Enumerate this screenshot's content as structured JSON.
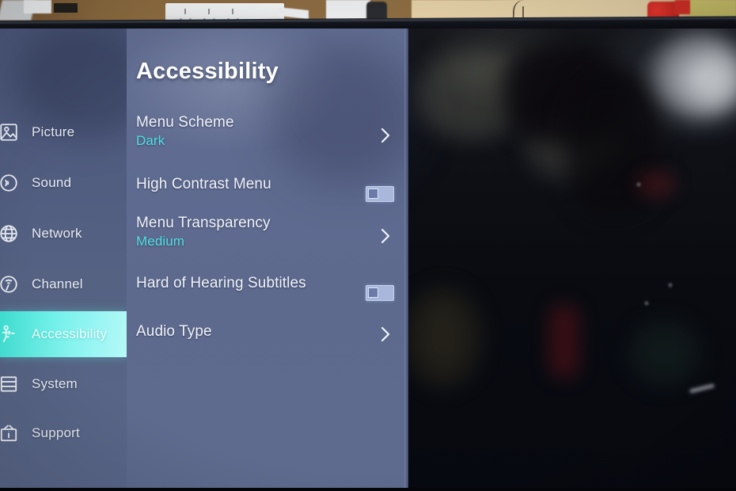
{
  "device": {
    "context": "tv-settings-menu-photo",
    "screen_bezel_color": "#0a0c12"
  },
  "menu": {
    "title": "Accessibility",
    "accent_color": "#4fe0e0",
    "highlight_color": "#62eee4",
    "panel_color": "#5d6a8e",
    "sidebar_color": "#515d80"
  },
  "sidebar": {
    "items": [
      {
        "label": "Picture",
        "icon": "picture-icon",
        "active": false
      },
      {
        "label": "Sound",
        "icon": "sound-icon",
        "active": false
      },
      {
        "label": "Network",
        "icon": "network-icon",
        "active": false
      },
      {
        "label": "Channel",
        "icon": "channel-icon",
        "active": false
      },
      {
        "label": "Accessibility",
        "icon": "accessibility-icon",
        "active": true
      },
      {
        "label": "System",
        "icon": "system-icon",
        "active": false
      },
      {
        "label": "Support",
        "icon": "support-icon",
        "active": false
      }
    ]
  },
  "settings": {
    "rows": [
      {
        "label": "Menu Scheme",
        "value": "Dark",
        "control": "chevron",
        "control_icon": "chevron-right-icon"
      },
      {
        "label": "High Contrast Menu",
        "value": "",
        "control": "toggle",
        "toggle_state": "off"
      },
      {
        "label": "Menu Transparency",
        "value": "Medium",
        "control": "chevron",
        "control_icon": "chevron-right-icon"
      },
      {
        "label": "Hard of Hearing Subtitles",
        "value": "",
        "control": "toggle",
        "toggle_state": "off"
      },
      {
        "label": "Audio Type",
        "value": "",
        "control": "chevron",
        "control_icon": "chevron-right-icon"
      }
    ]
  },
  "background": {
    "description": "wooden shelf with white power strip above the television, beige wall, red object and yellow wall at right"
  }
}
